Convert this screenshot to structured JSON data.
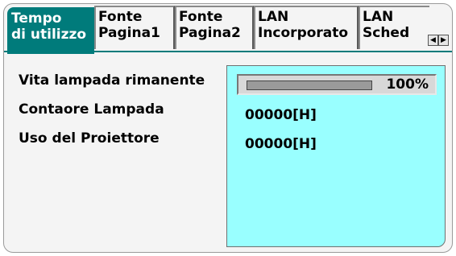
{
  "tabs": [
    {
      "line1": "Tempo",
      "line2": "di utilizzo",
      "active": true
    },
    {
      "line1": "Fonte",
      "line2": "Pagina1",
      "active": false
    },
    {
      "line1": "Fonte",
      "line2": "Pagina2",
      "active": false
    },
    {
      "line1": "LAN",
      "line2": "Incorporato",
      "active": false
    },
    {
      "line1": "LAN",
      "line2": "Sched",
      "active": false
    }
  ],
  "rows": {
    "lamp_life": {
      "label": "Vita lampada rimanente",
      "value": "100%",
      "fraction": 1.0
    },
    "lamp_hours": {
      "label": "Contaore Lampada",
      "value": "00000[H]"
    },
    "projector_usage": {
      "label": "Uso del Proiettore",
      "value": "00000[H]"
    }
  },
  "colors": {
    "active_tab": "#007b7b",
    "value_panel": "#99ffff"
  },
  "icons": {
    "scroll_left": "triangle-left",
    "scroll_right": "triangle-right"
  }
}
